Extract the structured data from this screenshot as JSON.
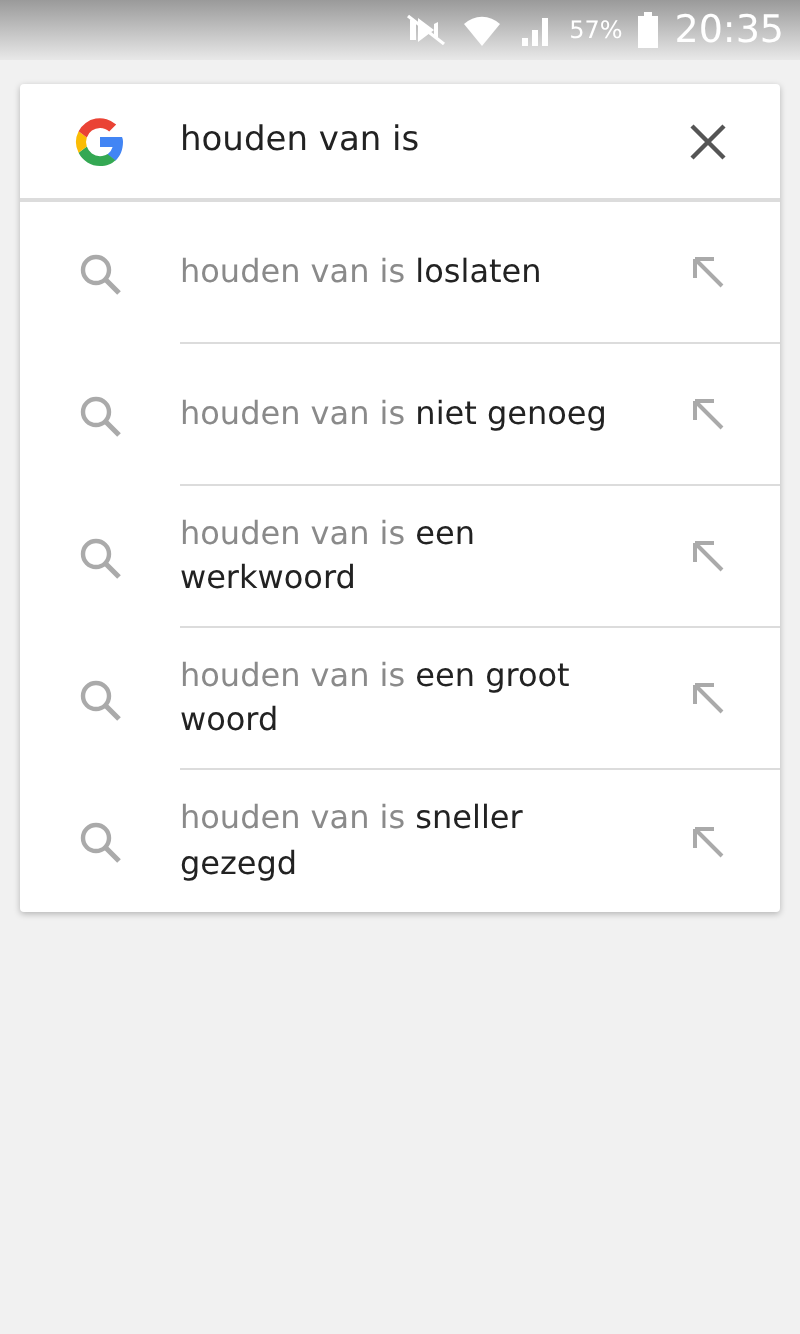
{
  "status_bar": {
    "battery_text": "57%",
    "time": "20:35"
  },
  "search": {
    "value": "houden van is"
  },
  "suggestions": [
    {
      "query": "houden van is",
      "completion": "loslaten"
    },
    {
      "query": "houden van is",
      "completion": "niet genoeg"
    },
    {
      "query": "houden van is",
      "completion": "een werkwoord"
    },
    {
      "query": "houden van is",
      "completion": "een groot woord"
    },
    {
      "query": "houden van is",
      "completion": "sneller gezegd"
    }
  ]
}
